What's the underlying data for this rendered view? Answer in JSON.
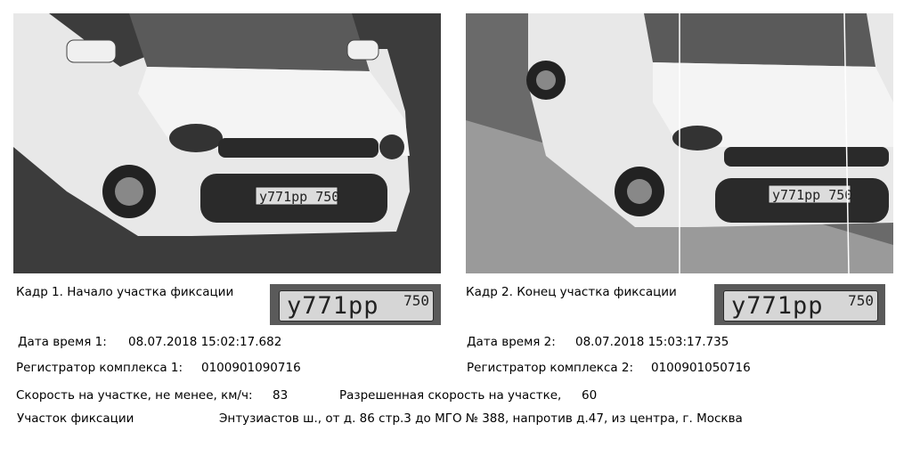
{
  "frame1": {
    "caption": "Кадр 1. Начало участка фиксации",
    "datetime_label": "Дата время 1:",
    "datetime_value": "08.07.2018 15:02:17.682",
    "registrar_label": "Регистратор комплекса 1:",
    "registrar_value": "0100901090716",
    "plate_number": "у771рр",
    "plate_region": "750"
  },
  "frame2": {
    "caption": "Кадр 2. Конец участка фиксации",
    "datetime_label": "Дата время 2:",
    "datetime_value": "08.07.2018 15:03:17.735",
    "registrar_label": "Регистратор комплекса 2:",
    "registrar_value": "0100901050716",
    "plate_number": "у771рр",
    "plate_region": "750"
  },
  "speed": {
    "label": "Скорость на участке, не менее,  км/ч:",
    "value": "83",
    "allowed_label": "Разрешенная скорость на участке,",
    "allowed_value": "60"
  },
  "section": {
    "label": "Участок фиксации",
    "value": "Энтузиастов ш., от д. 86 стр.3 до МГО № 388, напротив д.47, из центра, г. Москва"
  }
}
